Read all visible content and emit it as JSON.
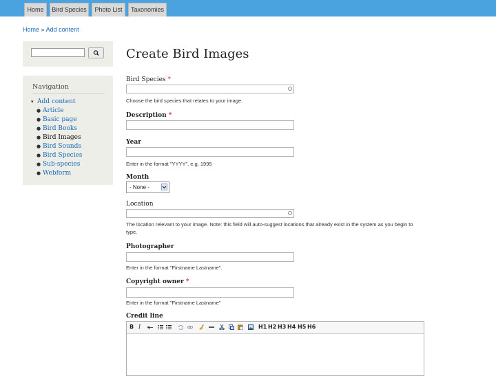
{
  "colors": {
    "topbar": "#4aa3df",
    "link": "#1a6bb8",
    "sidebar_bg": "#eeeee8",
    "required": "#cc3333"
  },
  "tabs": [
    {
      "label": "Home"
    },
    {
      "label": "Bird Species"
    },
    {
      "label": "Photo List"
    },
    {
      "label": "Taxonomies"
    }
  ],
  "breadcrumb": {
    "home": "Home",
    "sep": "»",
    "current": "Add content"
  },
  "sidebar": {
    "search": {
      "icon": "search-icon"
    },
    "nav": {
      "title": "Navigation",
      "parent": "Add content",
      "items": [
        {
          "label": "Article"
        },
        {
          "label": "Basic page"
        },
        {
          "label": "Bird Books"
        },
        {
          "label": "Bird Images"
        },
        {
          "label": "Bird Sounds"
        },
        {
          "label": "Bird Species"
        },
        {
          "label": "Sub-species"
        },
        {
          "label": "Webform"
        }
      ]
    }
  },
  "page": {
    "title": "Create Bird Images"
  },
  "form": {
    "required_marker": "*",
    "bird_species": {
      "label": "Bird Species",
      "help": "Choose the bird species that relates to your image."
    },
    "description": {
      "label": "Description"
    },
    "year": {
      "label": "Year",
      "help": "Enter in the format \"YYYY\", e.g. 1995"
    },
    "month": {
      "label": "Month",
      "selected": "- None -"
    },
    "location": {
      "label": "Location",
      "help": "The location relevant to your image. Note: this field will auto-suggest locations that already exist in the system as you begin to",
      "help2": "type."
    },
    "photographer": {
      "label": "Photographer",
      "help": "Enter in the format \"Firstname Lastname\"."
    },
    "copyright": {
      "label": "Copyright owner",
      "help": "Enter in the format \"Firstname Lastname\""
    },
    "credit": {
      "label": "Credit line"
    }
  },
  "editor_toolbar": {
    "bold": "B",
    "italic": "I",
    "headings": [
      "H1",
      "H2",
      "H3",
      "H4",
      "H5",
      "H6"
    ]
  }
}
